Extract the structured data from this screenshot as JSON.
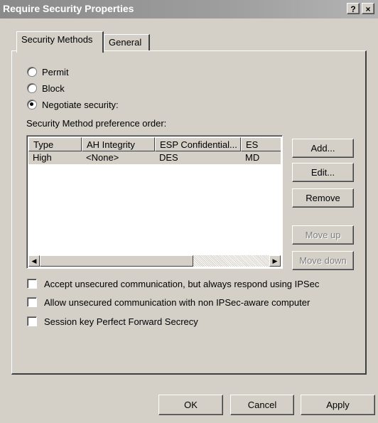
{
  "window": {
    "title": "Require Security Properties",
    "help_button": "?",
    "close_button": "×"
  },
  "tabs": [
    {
      "label": "Security Methods",
      "active": true
    },
    {
      "label": "General",
      "active": false
    }
  ],
  "radios": [
    {
      "label": "Permit",
      "selected": false
    },
    {
      "label": "Block",
      "selected": false
    },
    {
      "label": "Negotiate security:",
      "selected": true
    }
  ],
  "list_label": "Security Method preference order:",
  "list": {
    "columns": [
      "Type",
      "AH Integrity",
      "ESP Confidential...",
      "ES"
    ],
    "rows": [
      [
        "High",
        "<None>",
        "DES",
        "MD"
      ]
    ]
  },
  "side_buttons": {
    "add": "Add...",
    "edit": "Edit...",
    "remove": "Remove",
    "move_up": "Move up",
    "move_down": "Move down"
  },
  "checkboxes": [
    {
      "label": "Accept unsecured communication, but always respond using IPSec",
      "checked": false
    },
    {
      "label": "Allow unsecured communication with non IPSec-aware computer",
      "checked": false
    },
    {
      "label": "Session key Perfect Forward Secrecy",
      "checked": false
    }
  ],
  "footer": {
    "ok": "OK",
    "cancel": "Cancel",
    "apply": "Apply"
  }
}
